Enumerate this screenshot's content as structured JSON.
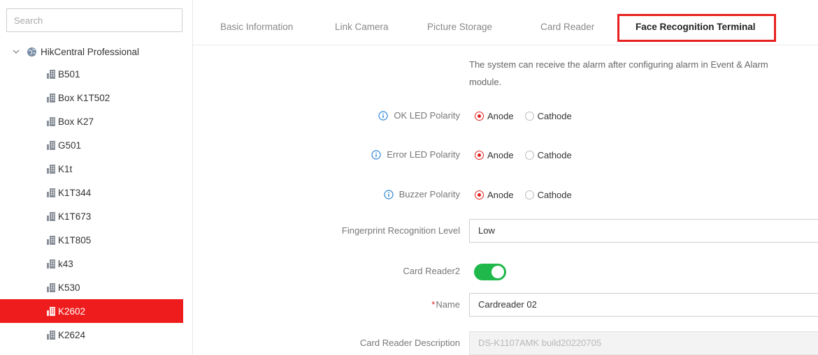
{
  "sidebar": {
    "search_placeholder": "Search",
    "root_label": "HikCentral Professional",
    "items": [
      {
        "label": "B501"
      },
      {
        "label": "Box K1T502"
      },
      {
        "label": "Box K27"
      },
      {
        "label": "G501"
      },
      {
        "label": "K1t"
      },
      {
        "label": "K1T344"
      },
      {
        "label": "K1T673"
      },
      {
        "label": "K1T805"
      },
      {
        "label": "k43"
      },
      {
        "label": "K530"
      },
      {
        "label": "K2602"
      },
      {
        "label": "K2624"
      }
    ],
    "selected_item": "K2602"
  },
  "tabs": [
    {
      "label": "Basic Information"
    },
    {
      "label": "Link Camera"
    },
    {
      "label": "Picture Storage"
    },
    {
      "label": "Card Reader"
    },
    {
      "label": "Face Recognition Terminal"
    }
  ],
  "active_tab": "Face Recognition Terminal",
  "form": {
    "note_line1": "The system can receive the alarm after configuring alarm in Event & Alarm",
    "note_line2": "module.",
    "ok_led": {
      "label": "OK LED Polarity",
      "opt1": "Anode",
      "opt2": "Cathode",
      "selected": "Anode"
    },
    "error_led": {
      "label": "Error LED Polarity",
      "opt1": "Anode",
      "opt2": "Cathode",
      "selected": "Anode"
    },
    "buzzer": {
      "label": "Buzzer Polarity",
      "opt1": "Anode",
      "opt2": "Cathode",
      "selected": "Anode"
    },
    "fingerprint": {
      "label": "Fingerprint Recognition Level",
      "value": "Low"
    },
    "card_reader2": {
      "label": "Card Reader2",
      "enabled": true
    },
    "name": {
      "required_mark": "*",
      "label": "Name",
      "value": "Cardreader 02"
    },
    "description": {
      "label": "Card Reader Description",
      "value": "DS-K1107AMK build20220705"
    }
  },
  "colors": {
    "accent": "#e8201f",
    "selected_bg": "#ee1c1c",
    "toggle_on": "#1fb84a"
  }
}
